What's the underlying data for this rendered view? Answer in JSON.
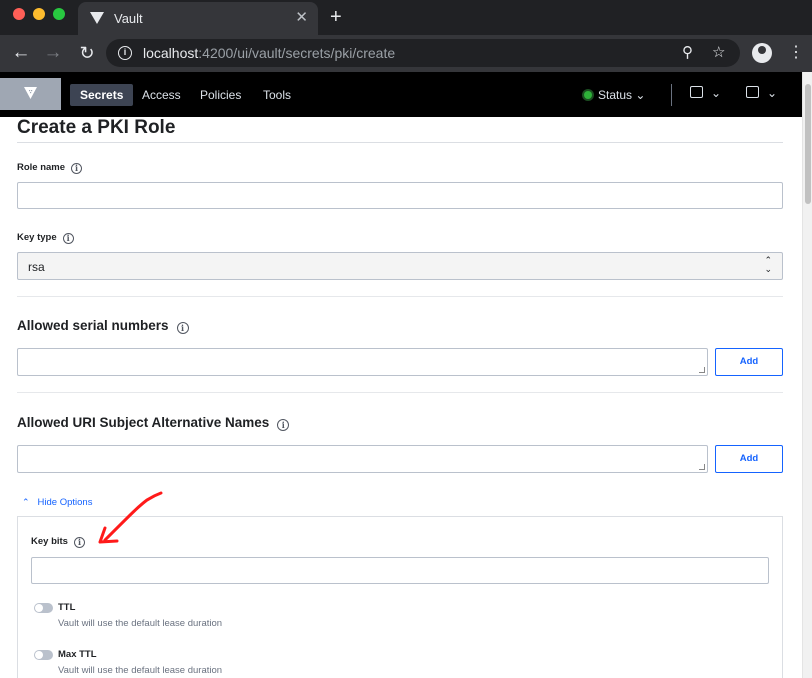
{
  "browser": {
    "tab_title": "Vault",
    "tab_close": "✕",
    "new_tab": "+",
    "url_host": "localhost",
    "url_rest": ":4200/ui/vault/secrets/pki/create"
  },
  "vault_nav": {
    "items": [
      {
        "label": "Secrets",
        "active": true
      },
      {
        "label": "Access",
        "active": false
      },
      {
        "label": "Policies",
        "active": false
      },
      {
        "label": "Tools",
        "active": false
      }
    ],
    "status_label": "Status",
    "status_color": "#2eb039"
  },
  "page": {
    "title": "Create a PKI Role",
    "role_name_label": "Role name",
    "role_name_value": "",
    "key_type_label": "Key type",
    "key_type_value": "rsa",
    "serials_label": "Allowed serial numbers",
    "uri_sans_label": "Allowed URI Subject Alternative Names",
    "add_label": "Add",
    "hide_options_label": "Hide Options",
    "key_bits_label": "Key bits",
    "key_bits_value": "",
    "ttl_label": "TTL",
    "ttl_help": "Vault will use the default lease duration",
    "max_ttl_label": "Max TTL",
    "max_ttl_help": "Vault will use the default lease duration"
  },
  "colors": {
    "accent": "#1563ff",
    "annotation_arrow": "#ff1a1a"
  }
}
